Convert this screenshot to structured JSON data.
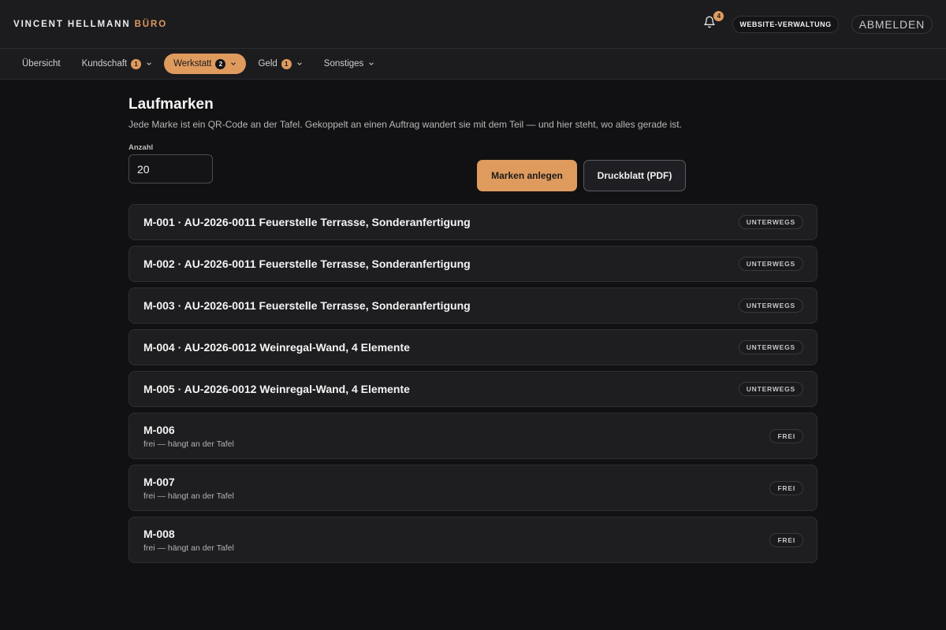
{
  "header": {
    "brand_name": "VINCENT HELLMANN",
    "brand_accent": "BÜRO",
    "notification_count": "4",
    "website_button": "WEBSITE-VERWALTUNG",
    "logout_button": "ABMELDEN"
  },
  "nav": {
    "items": [
      {
        "label": "Übersicht",
        "badge": ""
      },
      {
        "label": "Kundschaft",
        "badge": "1"
      },
      {
        "label": "Werkstatt",
        "badge": "2"
      },
      {
        "label": "Geld",
        "badge": "1"
      },
      {
        "label": "Sonstiges",
        "badge": ""
      }
    ],
    "active": "Werkstatt"
  },
  "page": {
    "title": "Laufmarken",
    "subtitle": "Jede Marke ist ein QR-Code an der Tafel. Gekoppelt an einen Auftrag wandert sie mit dem Teil — und hier steht, wo alles gerade ist."
  },
  "form": {
    "count_label": "Anzahl",
    "count_value": "20",
    "create_button": "Marken anlegen",
    "print_button": "Druckblatt (PDF)"
  },
  "marks": [
    {
      "title": "M-001 · AU-2026-0011 Feuerstelle Terrasse, Sonderanfertigung",
      "subtitle": "",
      "status": "UNTERWEGS"
    },
    {
      "title": "M-002 · AU-2026-0011 Feuerstelle Terrasse, Sonderanfertigung",
      "subtitle": "",
      "status": "UNTERWEGS"
    },
    {
      "title": "M-003 · AU-2026-0011 Feuerstelle Terrasse, Sonderanfertigung",
      "subtitle": "",
      "status": "UNTERWEGS"
    },
    {
      "title": "M-004 · AU-2026-0012 Weinregal-Wand, 4 Elemente",
      "subtitle": "",
      "status": "UNTERWEGS"
    },
    {
      "title": "M-005 · AU-2026-0012 Weinregal-Wand, 4 Elemente",
      "subtitle": "",
      "status": "UNTERWEGS"
    },
    {
      "title": "M-006",
      "subtitle": "frei — hängt an der Tafel",
      "status": "FREI"
    },
    {
      "title": "M-007",
      "subtitle": "frei — hängt an der Tafel",
      "status": "FREI"
    },
    {
      "title": "M-008",
      "subtitle": "frei — hängt an der Tafel",
      "status": "FREI"
    }
  ],
  "colors": {
    "accent": "#df9a5e",
    "background": "#111113",
    "surface": "#1e1e21"
  },
  "icons": {
    "notifications": "bell-icon",
    "dropdown": "chevron-down-icon"
  }
}
